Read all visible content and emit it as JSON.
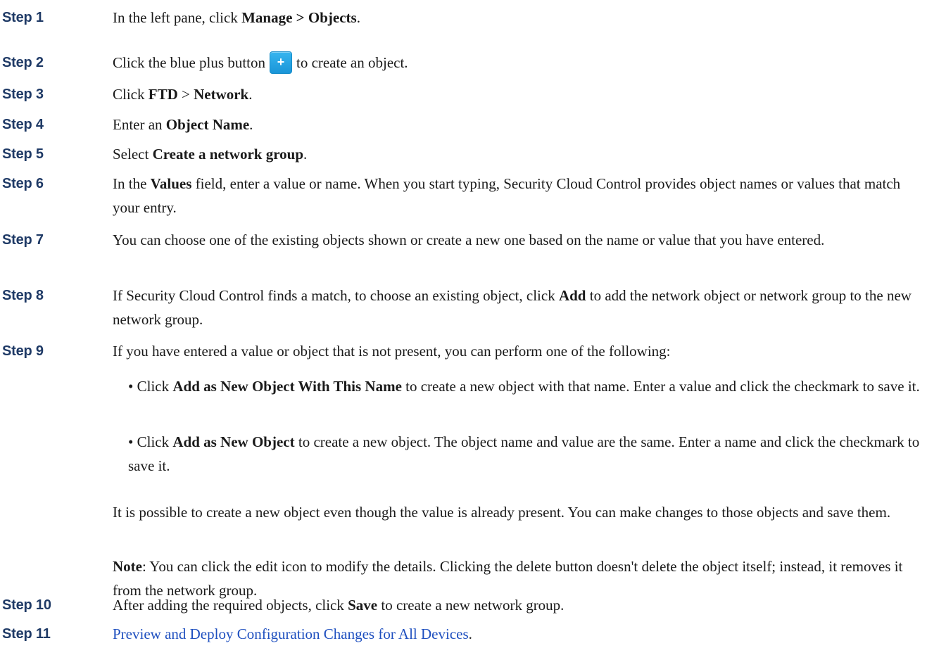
{
  "steps": [
    {
      "label": "Step 1",
      "parts": [
        "In the left pane, click ",
        "Manage > Objects",
        "."
      ]
    },
    {
      "label": "Step 2",
      "pre": "Click the blue plus button",
      "button_label": "+",
      "post": "to create an object."
    },
    {
      "label": "Step 3",
      "parts": [
        "Click ",
        "FTD",
        " > ",
        "Network",
        "."
      ]
    },
    {
      "label": "Step 4",
      "parts": [
        "Enter an ",
        "Object Name",
        "."
      ]
    },
    {
      "label": "Step 5",
      "parts": [
        "Select ",
        "Create a network group",
        "."
      ]
    },
    {
      "label": "Step 6",
      "parts": [
        "In the ",
        "Values",
        " field, enter a value or name. When you start typing, Security Cloud Control provides object names or values that match your entry."
      ]
    },
    {
      "label": "Step 7",
      "text": "You can choose one of the existing objects shown or create a new one based on the name or value that you have entered."
    },
    {
      "label": "Step 8",
      "parts": [
        "If Security Cloud Control finds a match, to choose an existing object, click ",
        "Add",
        " to add the network object or network group to the new network group."
      ]
    },
    {
      "label": "Step 9",
      "text": "If you have entered a value or object that is not present, you can perform one of the following:"
    },
    {
      "label": "Step 10",
      "parts": [
        "After adding the required objects, click ",
        "Save",
        " to create a new network group."
      ]
    },
    {
      "label": "Step 11",
      "link_text": "Preview and Deploy Configuration Changes for All Devices",
      "after": "."
    }
  ],
  "step9_bullets": [
    {
      "marker": "•",
      "parts": [
        "Click ",
        "Add as New Object With This Name",
        " to create a new object with that name. Enter a value and click the checkmark to save it."
      ]
    },
    {
      "marker": "•",
      "parts": [
        "Click ",
        "Add as New Object",
        " to create a new object. The object name and value are the same. Enter a name and click the checkmark to save it."
      ]
    }
  ],
  "step9_paragraph": "It is possible to create a new object even though the value is already present. You can make changes to those objects and save them.",
  "step9_note": {
    "label": "Note",
    "text": ": You can click the edit icon to modify the details. Clicking the delete button doesn't delete the object itself; instead, it removes it from the network group."
  },
  "colors": {
    "step_label": "#1f3a66",
    "link": "#1e4fbf",
    "plus_button": "#1a95d8"
  },
  "icons": {
    "plus_button_icon": "plus-icon"
  }
}
